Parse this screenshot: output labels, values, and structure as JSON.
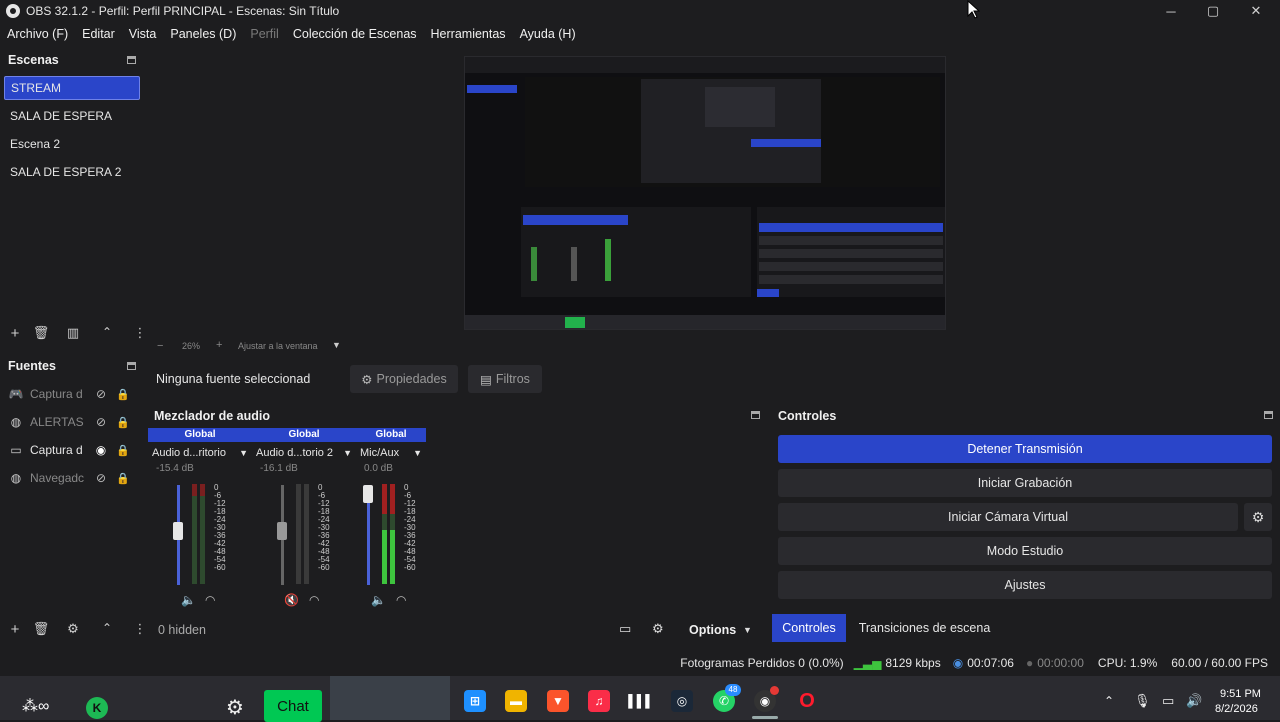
{
  "window": {
    "title": "OBS 32.1.2 - Perfil: Perfil PRINCIPAL - Escenas: Sin Título",
    "minimize": "─",
    "maximize": "▢",
    "close": "✕"
  },
  "menu": [
    "Archivo (F)",
    "Editar",
    "Vista",
    "Paneles (D)",
    "Perfil",
    "Colección de Escenas",
    "Herramientas",
    "Ayuda (H)"
  ],
  "scenes": {
    "title": "Escenas",
    "items": [
      "STREAM",
      "SALA DE ESPERA",
      "Escena 2",
      "SALA DE ESPERA 2"
    ],
    "active": "STREAM"
  },
  "preview": {
    "zoom": "26%",
    "fit_label": "Ajustar a la ventana",
    "minus": "−",
    "plus": "+"
  },
  "sources": {
    "title": "Fuentes",
    "items": [
      {
        "name": "Captura d",
        "icon": "gamepad-icon",
        "visible": false
      },
      {
        "name": "ALERTAS",
        "icon": "globe-icon",
        "visible": false
      },
      {
        "name": "Captura d",
        "icon": "monitor-icon",
        "visible": true
      },
      {
        "name": "Navegadc",
        "icon": "globe-icon",
        "visible": false
      }
    ]
  },
  "props_bar": {
    "no_source": "Ninguna fuente seleccionad",
    "properties": "Propiedades",
    "filters": "Filtros"
  },
  "mixer": {
    "title": "Mezclador de audio",
    "hidden": "0 hidden",
    "options": "Options",
    "scale": [
      "0",
      "-6",
      "-12",
      "-18",
      "-24",
      "-30",
      "-36",
      "-42",
      "-48",
      "-54",
      "-60"
    ],
    "channels": [
      {
        "header": "Global",
        "name": "Audio d...ritorio",
        "db": "-15.4 dB",
        "muted": false,
        "fader": 0.55
      },
      {
        "header": "Global",
        "name": "Audio d...torio 2",
        "db": "-16.1 dB",
        "muted": true,
        "fader": 0.55
      },
      {
        "header": "Global",
        "name": "Mic/Aux",
        "db": "0.0 dB",
        "muted": false,
        "fader": 1.0
      }
    ]
  },
  "controls": {
    "title": "Controles",
    "buttons": [
      "Detener Transmisión",
      "Iniciar Grabación",
      "Iniciar Cámara Virtual",
      "Modo Estudio",
      "Ajustes"
    ],
    "tabs": [
      "Controles",
      "Transiciones de escena"
    ]
  },
  "status": {
    "dropped": "Fotogramas Perdidos 0 (0.0%)",
    "bitrate": "8129 kbps",
    "stream_time": "00:07:06",
    "rec_time": "00:00:00",
    "cpu": "CPU: 1.9%",
    "fps": "60.00 / 60.00 FPS"
  },
  "taskbar": {
    "chat": "Chat",
    "time": "9:51 PM",
    "date": "8/2/2026",
    "badge": "48"
  },
  "colors": {
    "accent": "#2a45c9",
    "bg": "#1d1d1f",
    "panel": "#2a2a2e"
  }
}
